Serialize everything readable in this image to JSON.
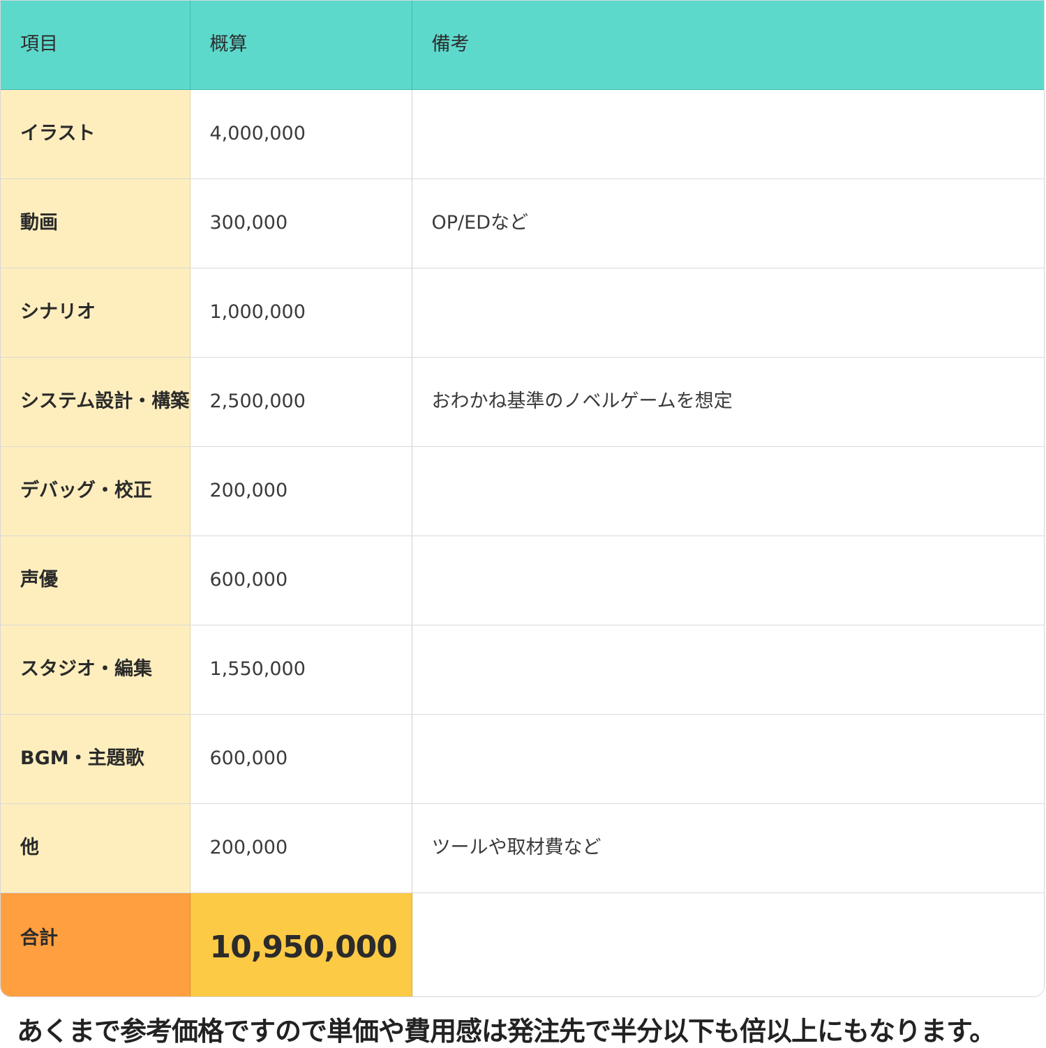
{
  "table": {
    "headers": [
      "項目",
      "概算",
      "備考"
    ],
    "rows": [
      {
        "item": "イラスト",
        "amount": "4,000,000",
        "note": ""
      },
      {
        "item": "動画",
        "amount": "300,000",
        "note": "OP/EDなど"
      },
      {
        "item": "シナリオ",
        "amount": "1,000,000",
        "note": ""
      },
      {
        "item": "システム設計・構築",
        "amount": "2,500,000",
        "note": "おわかね基準のノベルゲームを想定"
      },
      {
        "item": "デバッグ・校正",
        "amount": "200,000",
        "note": ""
      },
      {
        "item": "声優",
        "amount": "600,000",
        "note": ""
      },
      {
        "item": "スタジオ・編集",
        "amount": "1,550,000",
        "note": ""
      },
      {
        "item": "BGM・主題歌",
        "amount": "600,000",
        "note": ""
      },
      {
        "item": "他",
        "amount": "200,000",
        "note": "ツールや取材費など"
      }
    ],
    "total": {
      "label": "合計",
      "amount": "10,950,000",
      "note": ""
    }
  },
  "footnote": "あくまで参考価格ですので単価や費用感は発注先で半分以下も倍以上にもなります。",
  "colors": {
    "header_bg": "#5dd9cc",
    "item_bg": "#feeebe",
    "total_label_bg": "#ff9f40",
    "total_amount_bg": "#fdca45"
  }
}
